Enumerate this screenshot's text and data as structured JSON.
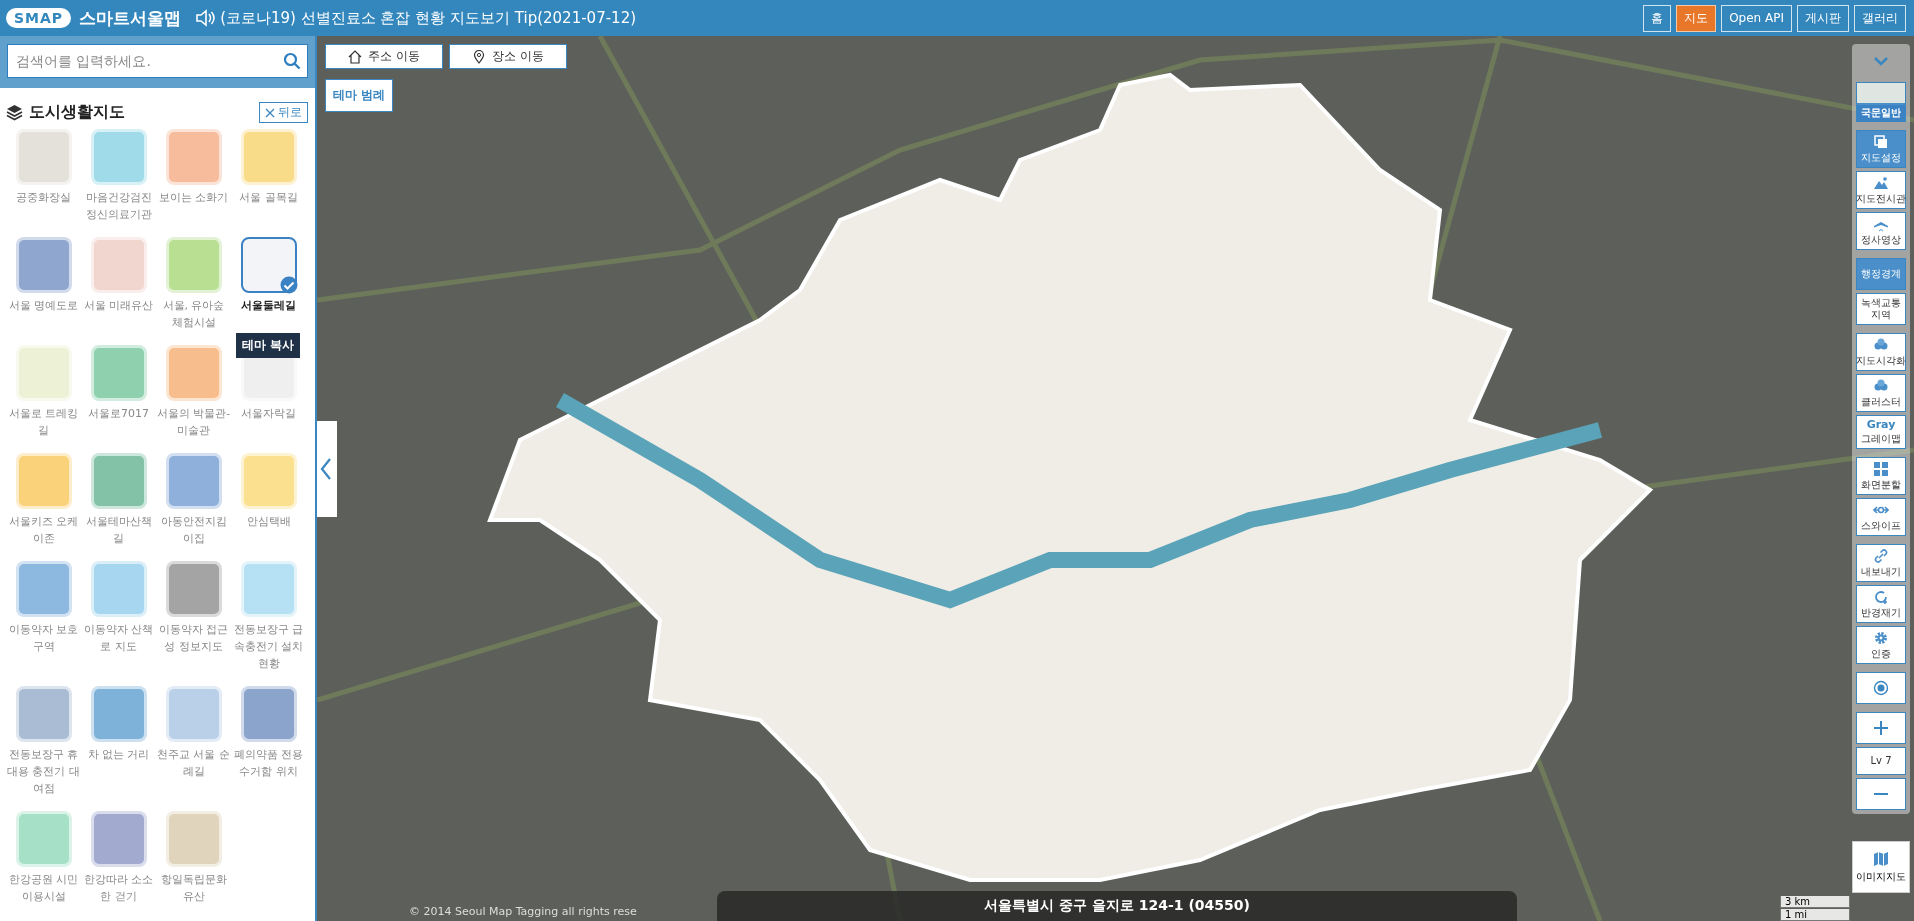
{
  "header": {
    "logo": "SMAP",
    "title": "스마트서울맵",
    "notice": "(코로나19) 선별진료소 혼잡 현황 지도보기 Tip(2021-07-12)",
    "nav": [
      {
        "label": "홈",
        "selected": false
      },
      {
        "label": "지도",
        "selected": true
      },
      {
        "label": "Open API",
        "selected": false
      },
      {
        "label": "게시판",
        "selected": false
      },
      {
        "label": "갤러리",
        "selected": false
      }
    ]
  },
  "sidebar": {
    "search": {
      "placeholder": "검색어를 입력하세요."
    },
    "heading": "도시생활지도",
    "back": "뒤로",
    "tooltip": "테마 복사",
    "themes": [
      {
        "label": "공중화장실",
        "color": "#e4e1da",
        "selected": false
      },
      {
        "label": "마음건강검진 정신의료기관",
        "color": "#9fdbe8",
        "selected": false
      },
      {
        "label": "보이는 소화기",
        "color": "#f6bc9c",
        "selected": false
      },
      {
        "label": "서울 골목길",
        "color": "#f9dc8a",
        "selected": false
      },
      {
        "label": "서울 명예도로",
        "color": "#8fa6cf",
        "selected": false
      },
      {
        "label": "서울 미래유산",
        "color": "#f1d5cf",
        "selected": false
      },
      {
        "label": "서울, 유아숲 체험시설",
        "color": "#b9df93",
        "selected": false
      },
      {
        "label": "서울둘레길",
        "color": "#f2f4f7",
        "selected": true
      },
      {
        "label": "서울로 트레킹길",
        "color": "#edf2d6",
        "selected": false
      },
      {
        "label": "서울로7017",
        "color": "#8fd0ae",
        "selected": false
      },
      {
        "label": "서울의 박물관-미술관",
        "color": "#f8bd8c",
        "selected": false
      },
      {
        "label": "서울자락길",
        "color": "#efefef",
        "selected": false
      },
      {
        "label": "서울키즈 오케이존",
        "color": "#f9d27a",
        "selected": false
      },
      {
        "label": "서울테마산책길",
        "color": "#84c2a8",
        "selected": false
      },
      {
        "label": "아동안전지킴이집",
        "color": "#8fb0da",
        "selected": false
      },
      {
        "label": "안심택배",
        "color": "#fbe08f",
        "selected": false
      },
      {
        "label": "이동약자 보호구역",
        "color": "#8db8e0",
        "selected": false
      },
      {
        "label": "이동약자 산책로 지도",
        "color": "#a6d6f0",
        "selected": false
      },
      {
        "label": "이동약자 접근성 정보지도",
        "color": "#a4a4a4",
        "selected": false
      },
      {
        "label": "전동보장구 급속충전기 설치현황",
        "color": "#b6e0f3",
        "selected": false
      },
      {
        "label": "전동보장구 휴대용 충전기 대여점",
        "color": "#a9bcd4",
        "selected": false
      },
      {
        "label": "차 없는 거리",
        "color": "#7fb2d9",
        "selected": false
      },
      {
        "label": "천주교 서울 순례길",
        "color": "#b9d0e8",
        "selected": false
      },
      {
        "label": "폐의약품 전용수거함 위치",
        "color": "#8aa4cc",
        "selected": false
      },
      {
        "label": "한강공원 시민이용시설",
        "color": "#a6e0c6",
        "selected": false
      },
      {
        "label": "한강따라 소소한 걷기",
        "color": "#a3aad0",
        "selected": false
      },
      {
        "label": "항일독립문화유산",
        "color": "#e0d4bc",
        "selected": false
      }
    ]
  },
  "map": {
    "address_button": "주소 이동",
    "place_button": "장소 이동",
    "legend_button": "테마 범례",
    "address": "서울특별시 중구 을지로 124-1 (04550)",
    "copyright": "© 2014 Seoul Map Tagging all rights rese",
    "scale": [
      "3 km",
      "1 mi"
    ],
    "image_map": "이미지지도"
  },
  "toolbar": [
    [
      {
        "kind": "collapse"
      }
    ],
    [
      {
        "kind": "thumb",
        "label": "국문일반",
        "selected": true
      }
    ],
    [
      {
        "kind": "layers",
        "label": "지도설정",
        "selected": true
      },
      {
        "kind": "mountain",
        "label": "지도전시관",
        "selected": false
      },
      {
        "kind": "plane",
        "label": "정사영상",
        "selected": false
      }
    ],
    [
      {
        "kind": "plain",
        "label": "행정경계",
        "selected": true
      },
      {
        "kind": "plain",
        "label": "녹색교통 지역",
        "selected": false
      }
    ],
    [
      {
        "kind": "cluster",
        "label": "지도시각화",
        "selected": false
      },
      {
        "kind": "cluster",
        "label": "클러스터",
        "selected": false
      },
      {
        "kind": "word",
        "word": "Gray",
        "label": "그레이맵",
        "selected": false
      }
    ],
    [
      {
        "kind": "grid",
        "label": "화면분할",
        "selected": false
      },
      {
        "kind": "swipe",
        "label": "스와이프",
        "selected": false
      }
    ],
    [
      {
        "kind": "link",
        "label": "내보내기",
        "selected": false
      },
      {
        "kind": "measure",
        "label": "반경재기",
        "selected": false
      },
      {
        "kind": "gear",
        "label": "인증",
        "selected": false
      }
    ],
    [
      {
        "kind": "locate"
      }
    ],
    [
      {
        "kind": "plus"
      },
      {
        "kind": "level",
        "label": "Lv 7"
      },
      {
        "kind": "minus"
      }
    ]
  ]
}
